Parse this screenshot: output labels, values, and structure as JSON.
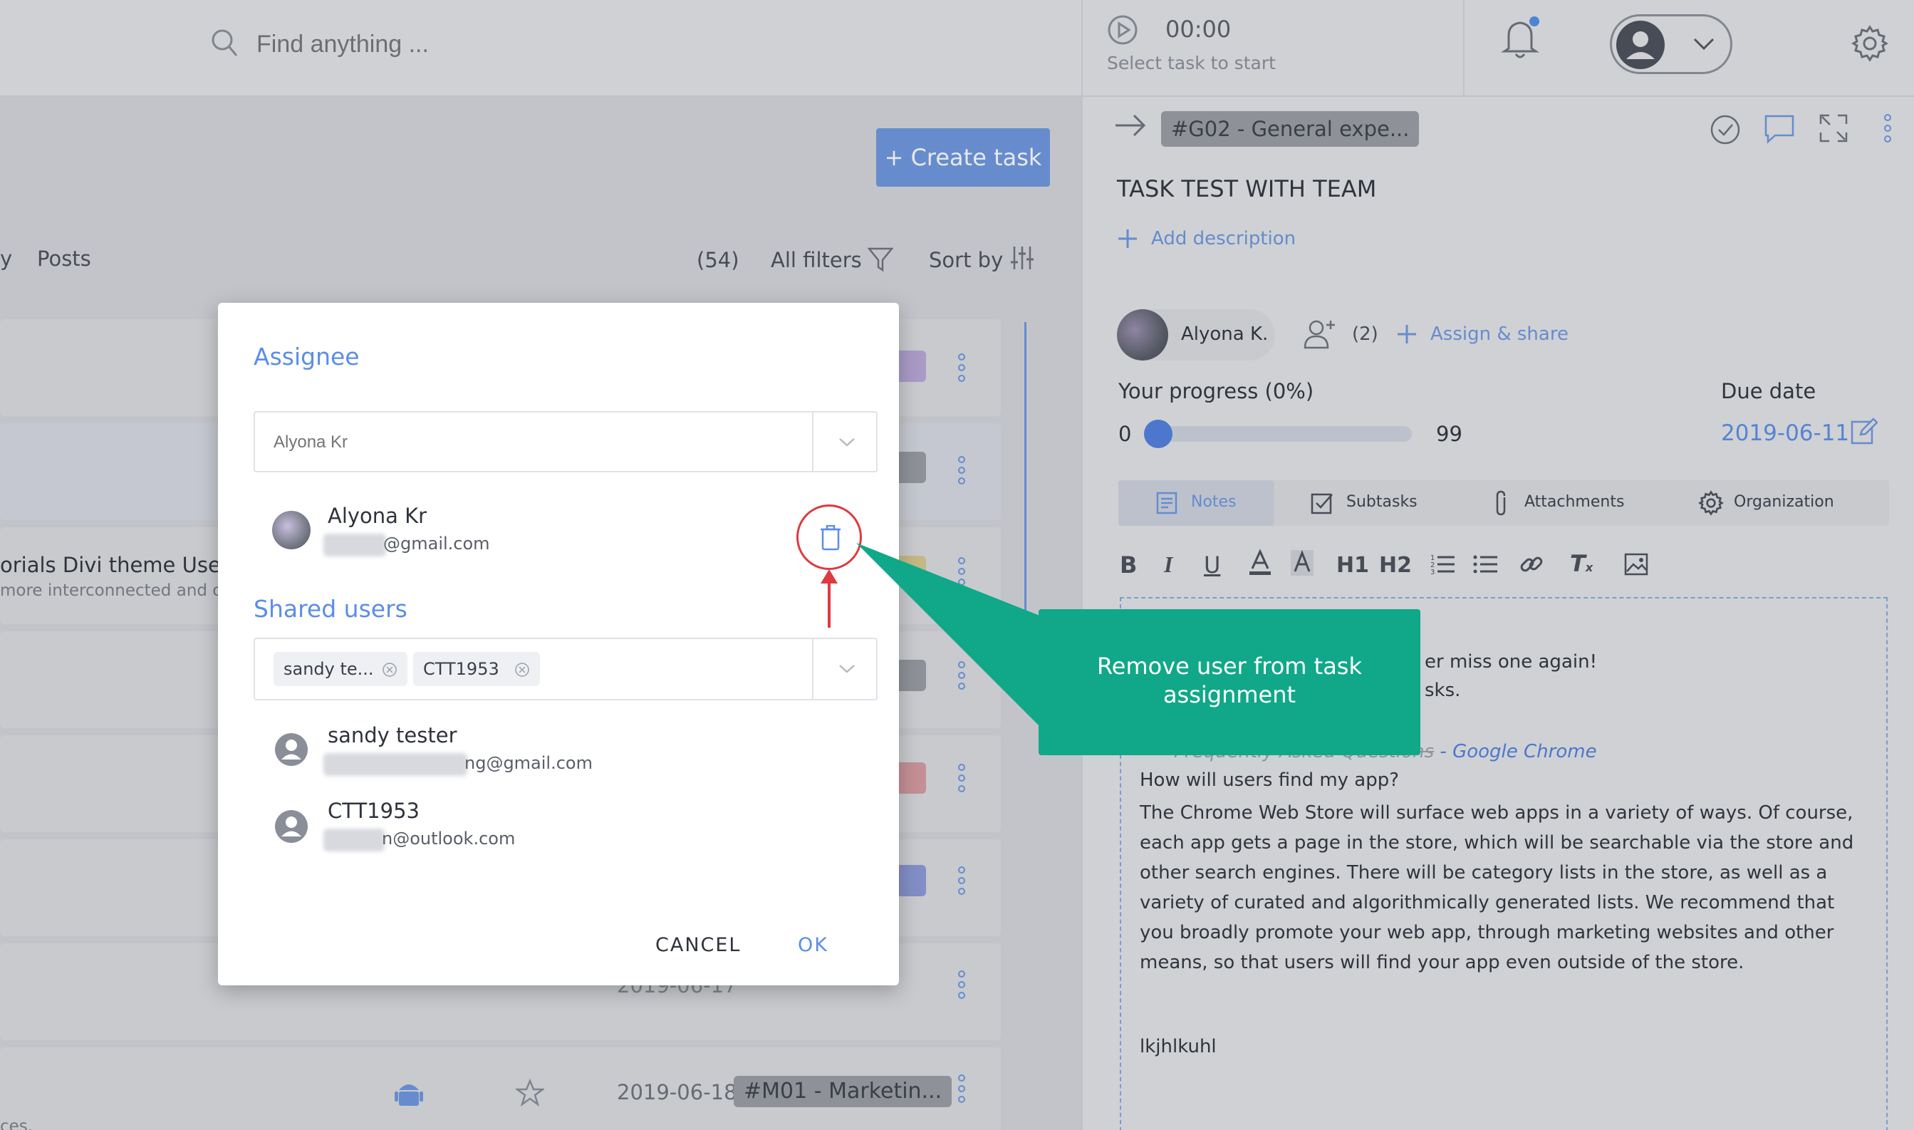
{
  "search": {
    "placeholder": "Find anything ..."
  },
  "timer": {
    "time": "00:00",
    "status": "Select task to start"
  },
  "list_header": {
    "create_task": "+ Create task",
    "tab_partial": "y",
    "tab_posts": "Posts",
    "count": "(54)",
    "all_filters": "All filters",
    "sort_by": "Sort by"
  },
  "rows": [
    {
      "title": "orials Divi theme Useful",
      "subtitle": "more interconnected and op"
    },
    {
      "subtitle": "ces.",
      "date_partial": "2019-06-17",
      "date": "2019-06-18",
      "tag": "#M01 - Marketin..."
    }
  ],
  "task": {
    "tag": "#G02 - General expe...",
    "title": "TASK TEST WITH TEAM",
    "add_description": "Add description",
    "assignee_name": "Alyona K.",
    "share_count": "(2)",
    "assign_share": "Assign & share",
    "progress_label": "Your progress  (0%)",
    "progress_min": "0",
    "progress_max": "99",
    "progress_value": 0,
    "due_label": "Due date",
    "due_date": "2019-06-11"
  },
  "tabs": [
    {
      "label": "Notes",
      "icon": "notes-icon"
    },
    {
      "label": "Subtasks",
      "icon": "subtasks-icon"
    },
    {
      "label": "Attachments",
      "icon": "paperclip-icon"
    },
    {
      "label": "Organization",
      "icon": "gear-icon"
    }
  ],
  "toolbar": {
    "h1": "H1",
    "h2": "H2"
  },
  "notes": {
    "line1": "er miss one again!",
    "line2": "sks.",
    "link_prefix": "Frequently Asked Questions",
    "link_suffix": " - Google Chrome",
    "question": "How will users find my app?",
    "body": "The Chrome Web Store will surface web apps in a variety of ways. Of course, each app gets a page in the store, which will be searchable via the store and other search engines. There will be category lists in the store, as well as a variety of curated and algorithmically generated lists. We recommend that you broadly promote your web app, through marketing websites and other means, so that users will find your app even outside of the store.",
    "footer": "lkjhlkuhl"
  },
  "modal": {
    "assignee_label": "Assignee",
    "assignee_placeholder": "Alyona Kr",
    "assignee": {
      "name": "Alyona Kr",
      "email": "@gmail.com"
    },
    "shared_label": "Shared users",
    "chips": [
      "sandy te...",
      "CTT1953"
    ],
    "shared": [
      {
        "name": "sandy tester",
        "email": "ng@gmail.com"
      },
      {
        "name": "CTT1953",
        "email": "n@outlook.com"
      }
    ],
    "cancel": "CANCEL",
    "ok": "OK"
  },
  "callout": {
    "text": "Remove user from task assignment"
  },
  "colors": {
    "accent": "#5b8de8",
    "callout": "#10a888",
    "danger": "#e0393e"
  }
}
